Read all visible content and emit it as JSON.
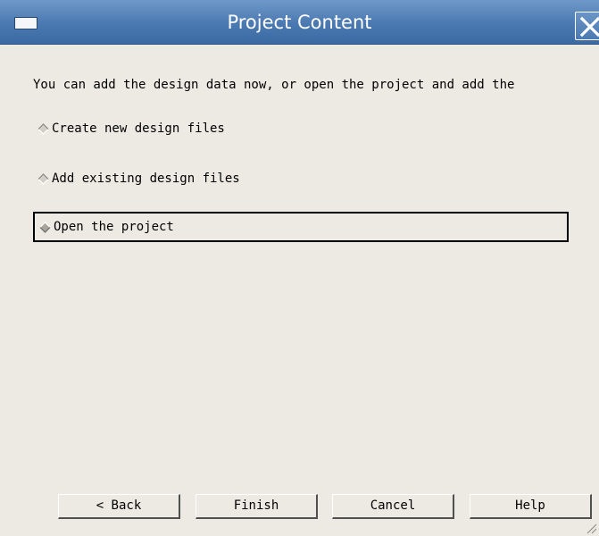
{
  "window": {
    "title": "Project Content",
    "menu_icon": "window-menu-icon",
    "close_icon": "close-icon"
  },
  "intro_text": "You can add the design data now, or open the project and add the",
  "options": [
    {
      "label": "Create new design files",
      "selected": false,
      "icon": "radio-diamond-icon"
    },
    {
      "label": "Add existing design files",
      "selected": false,
      "icon": "radio-diamond-icon"
    },
    {
      "label": "Open the project",
      "selected": true,
      "icon": "radio-diamond-icon"
    }
  ],
  "buttons": {
    "back": "< Back",
    "finish": "Finish",
    "cancel": "Cancel",
    "help": "Help"
  },
  "colors": {
    "titlebar": "#4a78b0",
    "background": "#edeae4"
  }
}
